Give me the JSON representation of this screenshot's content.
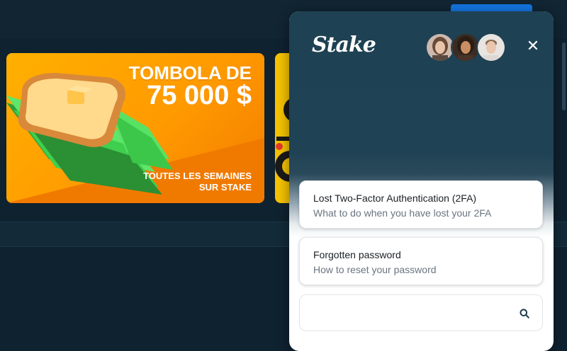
{
  "banner": {
    "title": "TOMBOLA DE",
    "amount": "75 000 $",
    "subtitle_line1": "TOUTES LES SEMAINES",
    "subtitle_line2": "SUR STAKE"
  },
  "widget": {
    "brand": "Stake",
    "avatars": [
      "avatar-woman-1",
      "avatar-woman-2",
      "avatar-man"
    ],
    "close_icon": "close-icon",
    "articles": [
      {
        "title": "Lost Two-Factor Authentication (2FA)",
        "subtitle": "What to do when you have lost your 2FA"
      },
      {
        "title": "Forgotten password",
        "subtitle": "How to reset your password"
      }
    ],
    "search": {
      "placeholder": "",
      "icon": "search-icon"
    }
  },
  "colors": {
    "page_bg": "#0f2230",
    "widget_header": "#1e4153",
    "topbar_button": "#1475e1",
    "banner_orange": "#ff9a00"
  }
}
